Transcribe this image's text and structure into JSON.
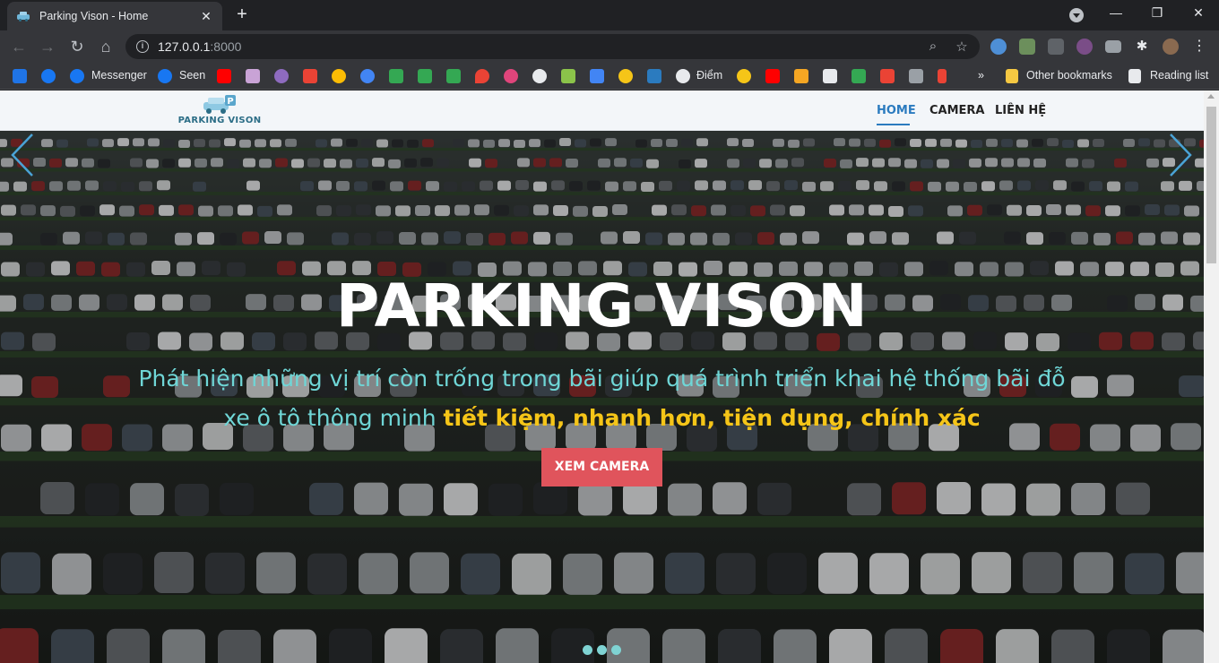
{
  "browser": {
    "tab_title": "Parking Vison - Home",
    "url_host": "127.0.0.1",
    "url_rest": ":8000",
    "bookmarks": {
      "messenger": "Messenger",
      "seen": "Seen",
      "diem": "Điểm",
      "other": "Other bookmarks",
      "reading": "Reading list"
    }
  },
  "site": {
    "logo_text": "PARKING VISON",
    "nav": [
      "HOME",
      "CAMERA",
      "LIÊN HỆ"
    ],
    "hero": {
      "title": "PARKING VISON",
      "subtitle_plain": "Phát hiện những vị trí còn trống trong bãi giúp quá trình triển khai hệ thống bãi đỗ xe ô tô thông minh ",
      "subtitle_highlight": "tiết kiệm, nhanh hơn, tiện dụng, chính xác",
      "cta": "XEM CAMERA"
    },
    "carousel": {
      "slides": 3,
      "active": 0
    }
  },
  "colors": {
    "accent": "#2b7bbf",
    "cta": "#e0545c",
    "subtitle": "#6fd6d6",
    "highlight": "#f5c518"
  }
}
